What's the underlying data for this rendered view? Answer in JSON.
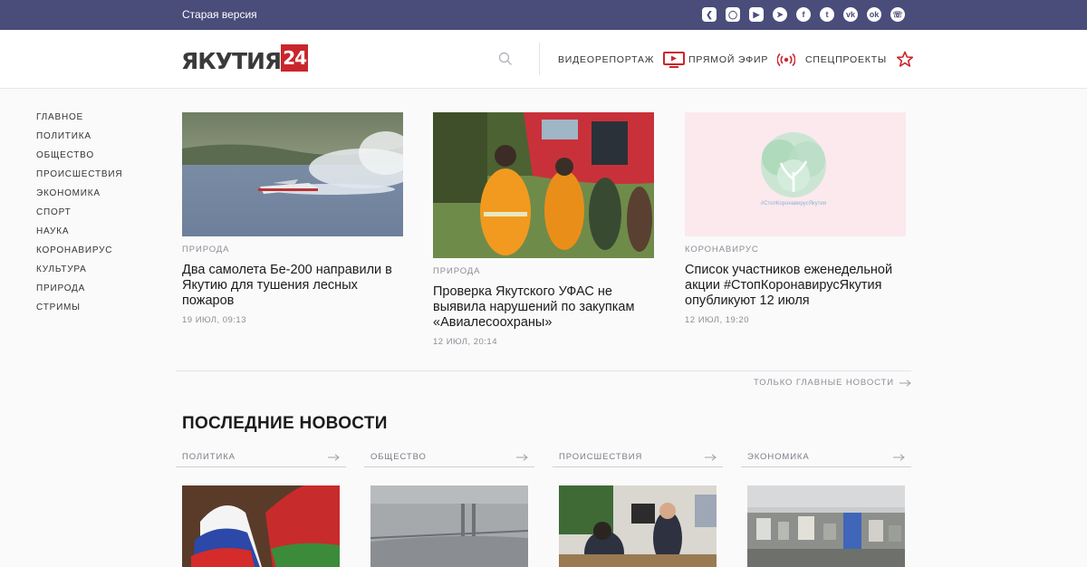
{
  "topbar": {
    "old_version": "Старая версия",
    "social_icons": [
      "kanal-icon",
      "instagram-icon",
      "youtube-icon",
      "telegram-icon",
      "facebook-icon",
      "twitter-icon",
      "vk-icon",
      "odnoklassniki-icon",
      "whatsapp-icon"
    ],
    "bg_color": "#4a4c7a"
  },
  "header": {
    "logo_text": "ЯКУТИЯ",
    "logo_num": "24",
    "nav": [
      {
        "label": "ВИДЕОРЕПОРТАЖ",
        "icon": "tv-icon"
      },
      {
        "label": "ПРЯМОЙ ЭФИР",
        "icon": "broadcast-icon"
      },
      {
        "label": "СПЕЦПРОЕКТЫ",
        "icon": "star-icon"
      }
    ],
    "accent_color": "#c9262c"
  },
  "sidebar": {
    "items": [
      "ГЛАВНОЕ",
      "ПОЛИТИКА",
      "ОБЩЕСТВО",
      "ПРОИСШЕСТВИЯ",
      "ЭКОНОМИКА",
      "СПОРТ",
      "НАУКА",
      "КОРОНАВИРУС",
      "КУЛЬТУРА",
      "ПРИРОДА",
      "СТРИМЫ"
    ]
  },
  "cards": [
    {
      "category": "ПРИРОДА",
      "title": "Два самолета Бе-200 направили в Якутию для тушения лесных пожаров",
      "date": "19 ИЮЛ, 09:13"
    },
    {
      "category": "ПРИРОДА",
      "title": "Проверка Якутского УФАС не выявила нарушений по закупкам «Авиалесоохраны»",
      "date": "12 ИЮЛ, 20:14"
    },
    {
      "category": "КОРОНАВИРУС",
      "title": "Список участников еженедельной акции #СтопКоронавирусЯкутия опубликуют 12 июля",
      "date": "12 ИЮЛ, 19:20",
      "image_caption": "#СтопКоронавирусЯкутия"
    }
  ],
  "only_main_news": "ТОЛЬКО ГЛАВНЫЕ НОВОСТИ",
  "latest": {
    "title": "ПОСЛЕДНИЕ НОВОСТИ",
    "columns": [
      "ПОЛИТИКА",
      "ОБЩЕСТВО",
      "ПРОИСШЕСТВИЯ",
      "ЭКОНОМИКА"
    ]
  }
}
